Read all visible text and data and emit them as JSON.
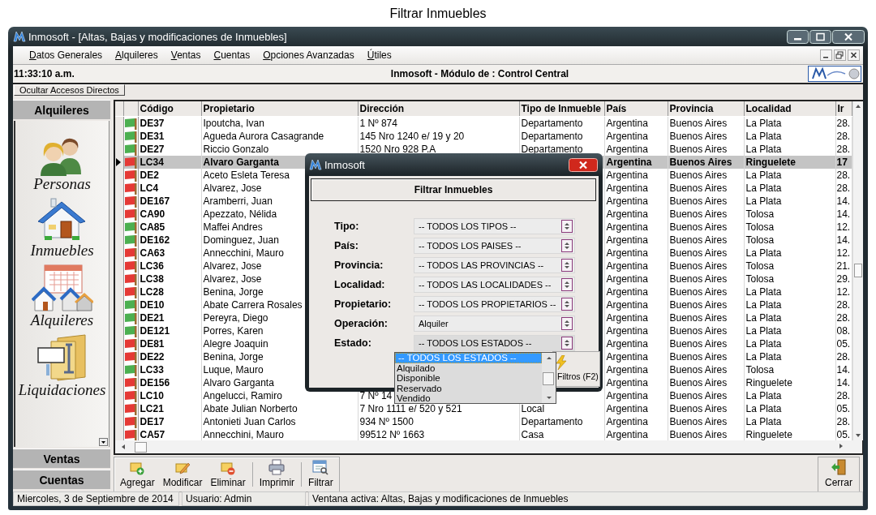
{
  "caption": "Filtrar Inmuebles",
  "window": {
    "title": "Inmosoft - [Altas, Bajas y modificaciones de Inmuebles]"
  },
  "menu": [
    "Datos Generales",
    "Alquileres",
    "Ventas",
    "Cuentas",
    "Opciones Avanzadas",
    "Útiles"
  ],
  "info_bar": {
    "time": "11:33:10 a.m.",
    "title": "Inmosoft - Módulo de : Control Central"
  },
  "toggle_button": "Ocultar Accesos Directos",
  "sidebar": {
    "sections": [
      {
        "label": "Alquileres",
        "items": [
          {
            "label": "Personas",
            "kind": "people"
          },
          {
            "label": "Inmuebles",
            "kind": "house"
          },
          {
            "label": "Alquileres",
            "kind": "rentals"
          },
          {
            "label": "Liquidaciones",
            "kind": "folder"
          }
        ]
      },
      {
        "label": "Ventas"
      },
      {
        "label": "Cuentas"
      }
    ]
  },
  "table": {
    "columns": [
      "Código",
      "Propietario",
      "Dirección",
      "Tipo de Inmueble",
      "País",
      "Provincia",
      "Localidad",
      "Ir"
    ],
    "rows": [
      {
        "color": "#4caf50",
        "selected": false,
        "codigo": "DE37",
        "propietario": "Ipoutcha, Ivan",
        "direccion": "1 Nº 874",
        "tipo_de_inmueble": "Departamento",
        "pais": "Argentina",
        "provincia": "Buenos Aires",
        "localidad": "La Plata",
        "column_9": "28."
      },
      {
        "color": "#4caf50",
        "selected": false,
        "codigo": "DE31",
        "propietario": "Agueda Aurora Casagrande",
        "direccion": "145 Nro 1240 e/ 19 y 20",
        "tipo_de_inmueble": "Departamento",
        "pais": "Argentina",
        "provincia": "Buenos Aires",
        "localidad": "La Plata",
        "column_9": "28."
      },
      {
        "color": "#4caf50",
        "selected": false,
        "codigo": "DE27",
        "propietario": "Riccio Gonzalo",
        "direccion": "1520 Nro 928 P.A",
        "tipo_de_inmueble": "Departamento",
        "pais": "Argentina",
        "provincia": "Buenos Aires",
        "localidad": "La Plata",
        "column_9": "28."
      },
      {
        "color": "#e53935",
        "selected": true,
        "codigo": "LC34",
        "propietario": "Alvaro Garganta",
        "pais": "Argentina",
        "provincia": "Buenos Aires",
        "localidad": "Ringuelete",
        "column_9": "17"
      },
      {
        "color": "#e53935",
        "selected": false,
        "codigo": "DE2",
        "propietario": "Aceto Esleta Teresa",
        "pais": "Argentina",
        "provincia": "Buenos Aires",
        "localidad": "La Plata",
        "column_9": "28."
      },
      {
        "color": "#e53935",
        "selected": false,
        "codigo": "LC4",
        "propietario": "Alvarez, Jose",
        "pais": "Argentina",
        "provincia": "Buenos Aires",
        "localidad": "La Plata",
        "column_9": "28."
      },
      {
        "color": "#e53935",
        "selected": false,
        "codigo": "DE167",
        "propietario": "Aramberri, Juan",
        "pais": "Argentina",
        "provincia": "Buenos Aires",
        "localidad": "La Plata",
        "column_9": "14."
      },
      {
        "color": "#e53935",
        "selected": false,
        "codigo": "CA90",
        "propietario": "Apezzato, Nélida",
        "pais": "Argentina",
        "provincia": "Buenos Aires",
        "localidad": "Tolosa",
        "column_9": "14."
      },
      {
        "color": "#4caf50",
        "selected": false,
        "codigo": "CA85",
        "propietario": "Maffei Andres",
        "pais": "Argentina",
        "provincia": "Buenos Aires",
        "localidad": "Tolosa",
        "column_9": "12."
      },
      {
        "color": "#4caf50",
        "selected": false,
        "codigo": "DE162",
        "propietario": "Dominguez, Juan",
        "pais": "Argentina",
        "provincia": "Buenos Aires",
        "localidad": "Tolosa",
        "column_9": "14."
      },
      {
        "color": "#e53935",
        "selected": false,
        "codigo": "CA63",
        "propietario": "Annecchini, Mauro",
        "pais": "Argentina",
        "provincia": "Buenos Aires",
        "localidad": "La Plata",
        "column_9": "12."
      },
      {
        "color": "#e53935",
        "selected": false,
        "codigo": "LC36",
        "propietario": "Alvarez, Jose",
        "pais": "Argentina",
        "provincia": "Buenos Aires",
        "localidad": "Tolosa",
        "column_9": "21."
      },
      {
        "color": "#e53935",
        "selected": false,
        "codigo": "LC38",
        "propietario": "Alvarez, Jose",
        "pais": "Argentina",
        "provincia": "Buenos Aires",
        "localidad": "Tolosa",
        "column_9": "29."
      },
      {
        "color": "#e53935",
        "selected": false,
        "codigo": "LC28",
        "propietario": "Benina, Jorge",
        "pais": "Argentina",
        "provincia": "Buenos Aires",
        "localidad": "La Plata",
        "column_9": "12."
      },
      {
        "color": "#4caf50",
        "selected": false,
        "codigo": "DE10",
        "propietario": "Abate Carrera Rosales",
        "pais": "Argentina",
        "provincia": "Buenos Aires",
        "localidad": "La Plata",
        "column_9": "28."
      },
      {
        "color": "#4caf50",
        "selected": false,
        "codigo": "DE21",
        "propietario": "Pereyra, Diego",
        "pais": "Argentina",
        "provincia": "Buenos Aires",
        "localidad": "La Plata",
        "column_9": "28."
      },
      {
        "color": "#4caf50",
        "selected": false,
        "codigo": "DE121",
        "propietario": "Porres, Karen",
        "pais": "Argentina",
        "provincia": "Buenos Aires",
        "localidad": "La Plata",
        "column_9": "08."
      },
      {
        "color": "#e53935",
        "selected": false,
        "codigo": "DE81",
        "propietario": "Alegre Joaquin",
        "pais": "Argentina",
        "provincia": "Buenos Aires",
        "localidad": "La Plata",
        "column_9": "05."
      },
      {
        "color": "#e53935",
        "selected": false,
        "codigo": "DE22",
        "propietario": "Benina, Jorge",
        "pais": "Argentina",
        "provincia": "Buenos Aires",
        "localidad": "La Plata",
        "column_9": "28."
      },
      {
        "color": "#4caf50",
        "selected": false,
        "codigo": "LC33",
        "propietario": "Luque, Mauro",
        "pais": "Argentina",
        "provincia": "Buenos Aires",
        "localidad": "Tolosa",
        "column_9": "14."
      },
      {
        "color": "#e53935",
        "selected": false,
        "codigo": "DE156",
        "propietario": "Alvaro Garganta",
        "pais": "Argentina",
        "provincia": "Buenos Aires",
        "localidad": "Ringuelete",
        "column_9": "14."
      },
      {
        "color": "#e53935",
        "selected": false,
        "codigo": "LC10",
        "propietario": "Angelucci, Ramiro",
        "direccion": "7 Nº 14",
        "pais": "Argentina",
        "provincia": "Buenos Aires",
        "localidad": "La Plata",
        "column_9": "28."
      },
      {
        "color": "#e53935",
        "selected": false,
        "codigo": "LC21",
        "propietario": "Abate Julian Norberto",
        "direccion": "7 Nro 1111 e/ 520 y 521",
        "tipo_de_inmueble": "Local",
        "pais": "Argentina",
        "provincia": "Buenos Aires",
        "localidad": "La Plata",
        "column_9": "05."
      },
      {
        "color": "#e53935",
        "selected": false,
        "codigo": "DE17",
        "propietario": "Antonieti  Juan Carlos",
        "direccion": "934 Nº 1500",
        "tipo_de_inmueble": "Departamento",
        "pais": "Argentina",
        "provincia": "Buenos Aires",
        "localidad": "La Plata",
        "column_9": "28."
      },
      {
        "color": "#e53935",
        "selected": false,
        "codigo": "CA57",
        "propietario": "Annecchini, Mauro",
        "direccion": "99512 Nº 1663",
        "tipo_de_inmueble": "Casa",
        "pais": "Argentina",
        "provincia": "Buenos Aires",
        "localidad": "Ringuelete",
        "column_9": "05."
      }
    ]
  },
  "dialog": {
    "title": "Inmosoft",
    "heading": "Filtrar Inmuebles",
    "fields": [
      {
        "label": "Tipo:",
        "value": "-- TODOS LOS TIPOS --",
        "open": false
      },
      {
        "label": "País:",
        "value": "-- TODOS LOS PAISES --",
        "open": false
      },
      {
        "label": "Provincia:",
        "value": "-- TODOS LAS PROVINCIAS --",
        "open": false
      },
      {
        "label": "Localidad:",
        "value": "-- TODOS LAS LOCALIDADES --",
        "open": false
      },
      {
        "label": "Propietario:",
        "value": "-- TODOS LOS PROPIETARIOS --",
        "open": false
      },
      {
        "label": "Operación:",
        "value": "Alquiler",
        "open": false
      },
      {
        "label": "Estado:",
        "value": "-- TODOS LOS ESTADOS --",
        "open": true,
        "options": [
          {
            "label": "-- TODOS LOS ESTADOS --",
            "selected": true
          },
          {
            "label": "Alquilado",
            "selected": false
          },
          {
            "label": "Disponible",
            "selected": false
          },
          {
            "label": "Reservado",
            "selected": false
          },
          {
            "label": "Vendido",
            "selected": false
          }
        ]
      }
    ],
    "button": "Filtros (F2)"
  },
  "toolbar": {
    "groups": [
      [
        {
          "label": "Agregar",
          "kind": "add"
        },
        {
          "label": "Modificar",
          "kind": "edit"
        },
        {
          "label": "Eliminar",
          "kind": "delete"
        }
      ],
      [
        {
          "label": "Imprimir",
          "kind": "print"
        }
      ],
      [
        {
          "label": "Filtrar",
          "kind": "filter"
        }
      ]
    ],
    "close_button": "Cerrar"
  },
  "status_bar": [
    "Miercoles, 3 de Septiembre de 2014",
    "Usuario: Admin",
    "Ventana activa: Altas, Bajas y modificaciones de Inmuebles"
  ]
}
